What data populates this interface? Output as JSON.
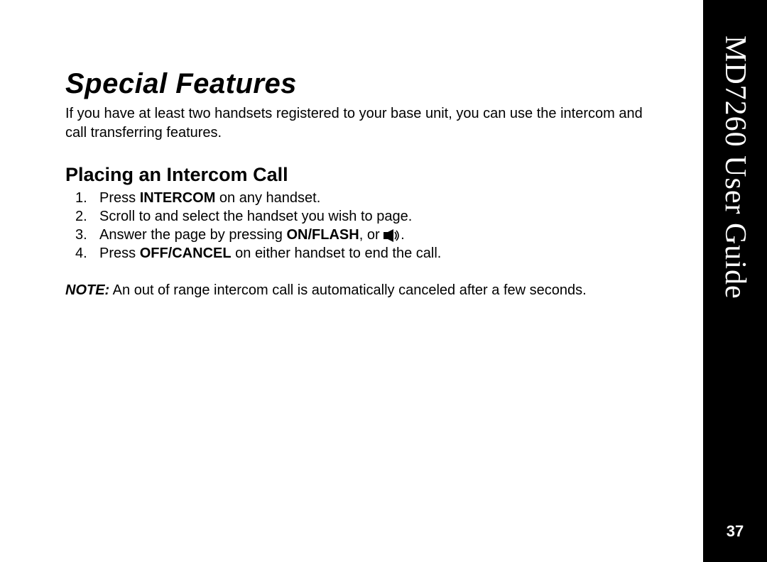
{
  "sidebar": {
    "title": "MD7260 User Guide",
    "page_number": "37"
  },
  "content": {
    "main_heading": "Special Features",
    "intro": "If you have at least two handsets registered to your base unit, you can use the intercom and call transferring features.",
    "sub_heading": "Placing an Intercom Call",
    "steps": [
      {
        "num": "1.",
        "pre": "Press ",
        "bold": "INTERCOM",
        "post": " on any handset."
      },
      {
        "num": "2.",
        "pre": "Scroll to and select the handset you wish to page.",
        "bold": "",
        "post": ""
      },
      {
        "num": "3.",
        "pre": "Answer the page by pressing ",
        "bold": "ON/FLASH",
        "post": ", or ",
        "icon": "speaker",
        "tail": "."
      },
      {
        "num": "4.",
        "pre": "Press ",
        "bold": "OFF/CANCEL",
        "post": " on either handset to end the call."
      }
    ],
    "note_label": "NOTE:",
    "note_text": "  An out of range intercom call is automatically canceled after a few seconds."
  }
}
